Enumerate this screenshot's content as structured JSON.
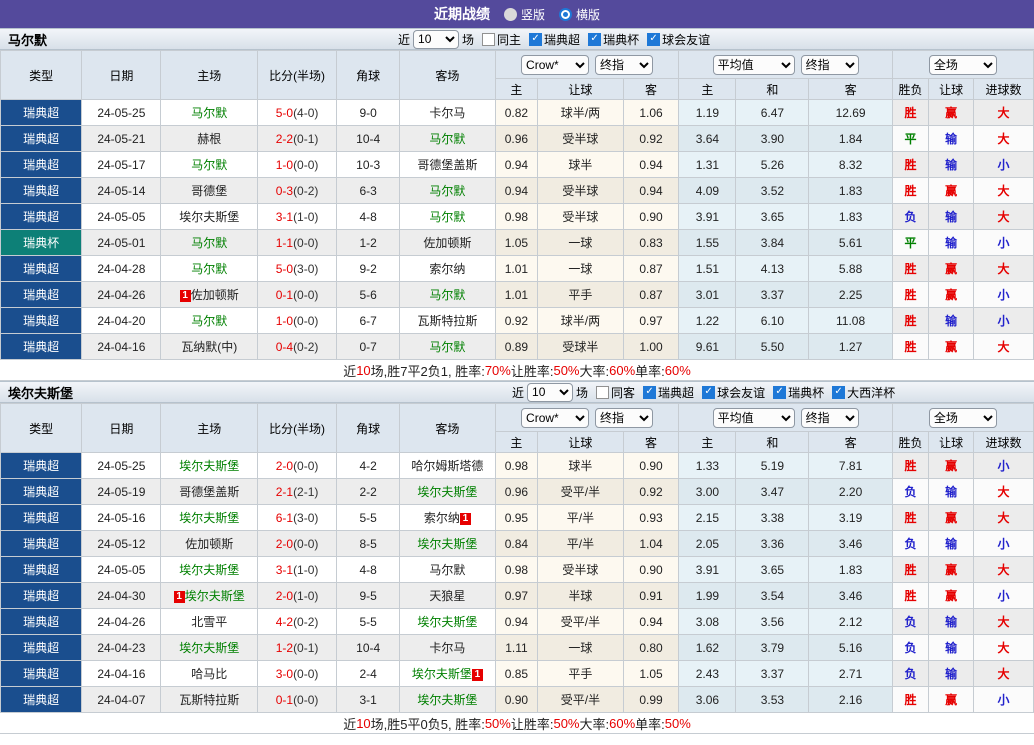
{
  "topbar": {
    "title": "近期战绩",
    "radios": [
      {
        "label": "竖版",
        "checked": false
      },
      {
        "label": "横版",
        "checked": true
      }
    ]
  },
  "colors": {
    "topbar_bg": "#544a9c",
    "league_super_bg": "#1a4e8e",
    "league_cup_bg": "#0d8077",
    "self_team_green": "#008000",
    "score_red": "#e60000",
    "result_red": "#e60000",
    "result_blue": "#2222cc",
    "result_green": "#008000",
    "checkbox_blue": "#1e78d7"
  },
  "result_color_map": {
    "胜": "red",
    "平": "green",
    "负": "blue",
    "赢": "red",
    "输": "blue",
    "大": "red",
    "小": "blue"
  },
  "table_header": {
    "left_cols": [
      "类型",
      "日期",
      "主场",
      "比分(半场)",
      "角球",
      "客场"
    ],
    "groups": [
      {
        "selects": [
          "Crow*",
          "终指"
        ],
        "cols": [
          "主",
          "让球",
          "客"
        ]
      },
      {
        "selects": [
          "平均值",
          "终指"
        ],
        "cols": [
          "主",
          "和",
          "客"
        ]
      },
      {
        "selects": [
          "全场"
        ],
        "cols": [
          "胜负",
          "让球",
          "进球数"
        ]
      }
    ]
  },
  "sections": [
    {
      "team": "马尔默",
      "filters": {
        "near": "近",
        "count": "10",
        "games": "场",
        "same": {
          "label": "同主",
          "checked": false
        },
        "leagues": [
          {
            "label": "瑞典超",
            "checked": true
          },
          {
            "label": "瑞典杯",
            "checked": true
          },
          {
            "label": "球会友谊",
            "checked": true
          }
        ]
      },
      "rows": [
        {
          "league": "瑞典超",
          "cup": false,
          "date": "24-05-25",
          "home": {
            "name": "马尔默",
            "self": true
          },
          "score": "5-0",
          "half": "(4-0)",
          "corners": "9-0",
          "away": {
            "name": "卡尔马",
            "self": false
          },
          "odds": [
            "0.82",
            "球半/两",
            "1.06"
          ],
          "avg": [
            "1.19",
            "6.47",
            "12.69"
          ],
          "results": [
            "胜",
            "赢",
            "大"
          ]
        },
        {
          "league": "瑞典超",
          "cup": false,
          "date": "24-05-21",
          "home": {
            "name": "赫根",
            "self": false
          },
          "score": "2-2",
          "half": "(0-1)",
          "corners": "10-4",
          "away": {
            "name": "马尔默",
            "self": true
          },
          "odds": [
            "0.96",
            "受半球",
            "0.92"
          ],
          "avg": [
            "3.64",
            "3.90",
            "1.84"
          ],
          "results": [
            "平",
            "输",
            "大"
          ]
        },
        {
          "league": "瑞典超",
          "cup": false,
          "date": "24-05-17",
          "home": {
            "name": "马尔默",
            "self": true
          },
          "score": "1-0",
          "half": "(0-0)",
          "corners": "10-3",
          "away": {
            "name": "哥德堡盖斯",
            "self": false
          },
          "odds": [
            "0.94",
            "球半",
            "0.94"
          ],
          "avg": [
            "1.31",
            "5.26",
            "8.32"
          ],
          "results": [
            "胜",
            "输",
            "小"
          ]
        },
        {
          "league": "瑞典超",
          "cup": false,
          "date": "24-05-14",
          "home": {
            "name": "哥德堡",
            "self": false
          },
          "score": "0-3",
          "half": "(0-2)",
          "corners": "6-3",
          "away": {
            "name": "马尔默",
            "self": true
          },
          "odds": [
            "0.94",
            "受半球",
            "0.94"
          ],
          "avg": [
            "4.09",
            "3.52",
            "1.83"
          ],
          "results": [
            "胜",
            "赢",
            "大"
          ]
        },
        {
          "league": "瑞典超",
          "cup": false,
          "date": "24-05-05",
          "home": {
            "name": "埃尔夫斯堡",
            "self": false
          },
          "score": "3-1",
          "half": "(1-0)",
          "corners": "4-8",
          "away": {
            "name": "马尔默",
            "self": true
          },
          "odds": [
            "0.98",
            "受半球",
            "0.90"
          ],
          "avg": [
            "3.91",
            "3.65",
            "1.83"
          ],
          "results": [
            "负",
            "输",
            "大"
          ]
        },
        {
          "league": "瑞典杯",
          "cup": true,
          "date": "24-05-01",
          "home": {
            "name": "马尔默",
            "self": true
          },
          "score": "1-1",
          "half": "(0-0)",
          "corners": "1-2",
          "away": {
            "name": "佐加顿斯",
            "self": false
          },
          "odds": [
            "1.05",
            "一球",
            "0.83"
          ],
          "avg": [
            "1.55",
            "3.84",
            "5.61"
          ],
          "results": [
            "平",
            "输",
            "小"
          ]
        },
        {
          "league": "瑞典超",
          "cup": false,
          "date": "24-04-28",
          "home": {
            "name": "马尔默",
            "self": true
          },
          "score": "5-0",
          "half": "(3-0)",
          "corners": "9-2",
          "away": {
            "name": "索尔纳",
            "self": false
          },
          "odds": [
            "1.01",
            "一球",
            "0.87"
          ],
          "avg": [
            "1.51",
            "4.13",
            "5.88"
          ],
          "results": [
            "胜",
            "赢",
            "大"
          ]
        },
        {
          "league": "瑞典超",
          "cup": false,
          "date": "24-04-26",
          "home": {
            "name": "佐加顿斯",
            "self": false,
            "card": "pre"
          },
          "score": "0-1",
          "half": "(0-0)",
          "corners": "5-6",
          "away": {
            "name": "马尔默",
            "self": true
          },
          "odds": [
            "1.01",
            "平手",
            "0.87"
          ],
          "avg": [
            "3.01",
            "3.37",
            "2.25"
          ],
          "results": [
            "胜",
            "赢",
            "小"
          ]
        },
        {
          "league": "瑞典超",
          "cup": false,
          "date": "24-04-20",
          "home": {
            "name": "马尔默",
            "self": true
          },
          "score": "1-0",
          "half": "(0-0)",
          "corners": "6-7",
          "away": {
            "name": "瓦斯特拉斯",
            "self": false
          },
          "odds": [
            "0.92",
            "球半/两",
            "0.97"
          ],
          "avg": [
            "1.22",
            "6.10",
            "11.08"
          ],
          "results": [
            "胜",
            "输",
            "小"
          ]
        },
        {
          "league": "瑞典超",
          "cup": false,
          "date": "24-04-16",
          "home": {
            "name": "瓦纳默(中)",
            "self": false
          },
          "score": "0-4",
          "half": "(0-2)",
          "corners": "0-7",
          "away": {
            "name": "马尔默",
            "self": true
          },
          "odds": [
            "0.89",
            "受球半",
            "1.00"
          ],
          "avg": [
            "9.61",
            "5.50",
            "1.27"
          ],
          "results": [
            "胜",
            "赢",
            "大"
          ]
        }
      ],
      "summary": [
        {
          "t": "近"
        },
        {
          "t": "10",
          "red": true
        },
        {
          "t": "场,胜7平2负1, 胜率:"
        },
        {
          "t": "70%",
          "red": true
        },
        {
          "t": " 让胜率:"
        },
        {
          "t": "50%",
          "red": true
        },
        {
          "t": " 大率:"
        },
        {
          "t": "60%",
          "red": true
        },
        {
          "t": " 单率:"
        },
        {
          "t": "60%",
          "red": true
        }
      ]
    },
    {
      "team": "埃尔夫斯堡",
      "filters": {
        "near": "近",
        "count": "10",
        "games": "场",
        "same": {
          "label": "同客",
          "checked": false
        },
        "leagues": [
          {
            "label": "瑞典超",
            "checked": true
          },
          {
            "label": "球会友谊",
            "checked": true
          },
          {
            "label": "瑞典杯",
            "checked": true
          },
          {
            "label": "大西洋杯",
            "checked": true
          }
        ]
      },
      "rows": [
        {
          "league": "瑞典超",
          "cup": false,
          "date": "24-05-25",
          "home": {
            "name": "埃尔夫斯堡",
            "self": true
          },
          "score": "2-0",
          "half": "(0-0)",
          "corners": "4-2",
          "away": {
            "name": "哈尔姆斯塔德",
            "self": false
          },
          "odds": [
            "0.98",
            "球半",
            "0.90"
          ],
          "avg": [
            "1.33",
            "5.19",
            "7.81"
          ],
          "results": [
            "胜",
            "赢",
            "小"
          ]
        },
        {
          "league": "瑞典超",
          "cup": false,
          "date": "24-05-19",
          "home": {
            "name": "哥德堡盖斯",
            "self": false
          },
          "score": "2-1",
          "half": "(2-1)",
          "corners": "2-2",
          "away": {
            "name": "埃尔夫斯堡",
            "self": true
          },
          "odds": [
            "0.96",
            "受平/半",
            "0.92"
          ],
          "avg": [
            "3.00",
            "3.47",
            "2.20"
          ],
          "results": [
            "负",
            "输",
            "大"
          ]
        },
        {
          "league": "瑞典超",
          "cup": false,
          "date": "24-05-16",
          "home": {
            "name": "埃尔夫斯堡",
            "self": true
          },
          "score": "6-1",
          "half": "(3-0)",
          "corners": "5-5",
          "away": {
            "name": "索尔纳",
            "self": false,
            "card": "post"
          },
          "odds": [
            "0.95",
            "平/半",
            "0.93"
          ],
          "avg": [
            "2.15",
            "3.38",
            "3.19"
          ],
          "results": [
            "胜",
            "赢",
            "大"
          ]
        },
        {
          "league": "瑞典超",
          "cup": false,
          "date": "24-05-12",
          "home": {
            "name": "佐加顿斯",
            "self": false
          },
          "score": "2-0",
          "half": "(0-0)",
          "corners": "8-5",
          "away": {
            "name": "埃尔夫斯堡",
            "self": true
          },
          "odds": [
            "0.84",
            "平/半",
            "1.04"
          ],
          "avg": [
            "2.05",
            "3.36",
            "3.46"
          ],
          "results": [
            "负",
            "输",
            "小"
          ]
        },
        {
          "league": "瑞典超",
          "cup": false,
          "date": "24-05-05",
          "home": {
            "name": "埃尔夫斯堡",
            "self": true
          },
          "score": "3-1",
          "half": "(1-0)",
          "corners": "4-8",
          "away": {
            "name": "马尔默",
            "self": false
          },
          "odds": [
            "0.98",
            "受半球",
            "0.90"
          ],
          "avg": [
            "3.91",
            "3.65",
            "1.83"
          ],
          "results": [
            "胜",
            "赢",
            "大"
          ]
        },
        {
          "league": "瑞典超",
          "cup": false,
          "date": "24-04-30",
          "home": {
            "name": "埃尔夫斯堡",
            "self": true,
            "card": "pre"
          },
          "score": "2-0",
          "half": "(1-0)",
          "corners": "9-5",
          "away": {
            "name": "天狼星",
            "self": false
          },
          "odds": [
            "0.97",
            "半球",
            "0.91"
          ],
          "avg": [
            "1.99",
            "3.54",
            "3.46"
          ],
          "results": [
            "胜",
            "赢",
            "小"
          ]
        },
        {
          "league": "瑞典超",
          "cup": false,
          "date": "24-04-26",
          "home": {
            "name": "北雪平",
            "self": false
          },
          "score": "4-2",
          "half": "(0-2)",
          "corners": "5-5",
          "away": {
            "name": "埃尔夫斯堡",
            "self": true
          },
          "odds": [
            "0.94",
            "受平/半",
            "0.94"
          ],
          "avg": [
            "3.08",
            "3.56",
            "2.12"
          ],
          "results": [
            "负",
            "输",
            "大"
          ]
        },
        {
          "league": "瑞典超",
          "cup": false,
          "date": "24-04-23",
          "home": {
            "name": "埃尔夫斯堡",
            "self": true
          },
          "score": "1-2",
          "half": "(0-1)",
          "corners": "10-4",
          "away": {
            "name": "卡尔马",
            "self": false
          },
          "odds": [
            "1.11",
            "一球",
            "0.80"
          ],
          "avg": [
            "1.62",
            "3.79",
            "5.16"
          ],
          "results": [
            "负",
            "输",
            "大"
          ]
        },
        {
          "league": "瑞典超",
          "cup": false,
          "date": "24-04-16",
          "home": {
            "name": "哈马比",
            "self": false
          },
          "score": "3-0",
          "half": "(0-0)",
          "corners": "2-4",
          "away": {
            "name": "埃尔夫斯堡",
            "self": true,
            "card": "post"
          },
          "odds": [
            "0.85",
            "平手",
            "1.05"
          ],
          "avg": [
            "2.43",
            "3.37",
            "2.71"
          ],
          "results": [
            "负",
            "输",
            "大"
          ]
        },
        {
          "league": "瑞典超",
          "cup": false,
          "date": "24-04-07",
          "home": {
            "name": "瓦斯特拉斯",
            "self": false
          },
          "score": "0-1",
          "half": "(0-0)",
          "corners": "3-1",
          "away": {
            "name": "埃尔夫斯堡",
            "self": true
          },
          "odds": [
            "0.90",
            "受平/半",
            "0.99"
          ],
          "avg": [
            "3.06",
            "3.53",
            "2.16"
          ],
          "results": [
            "胜",
            "赢",
            "小"
          ]
        }
      ],
      "summary": [
        {
          "t": "近"
        },
        {
          "t": "10",
          "red": true
        },
        {
          "t": "场,胜5平0负5, 胜率:"
        },
        {
          "t": "50%",
          "red": true
        },
        {
          "t": " 让胜率:"
        },
        {
          "t": "50%",
          "red": true
        },
        {
          "t": " 大率:"
        },
        {
          "t": "60%",
          "red": true
        },
        {
          "t": " 单率:"
        },
        {
          "t": "50%",
          "red": true
        }
      ]
    }
  ]
}
